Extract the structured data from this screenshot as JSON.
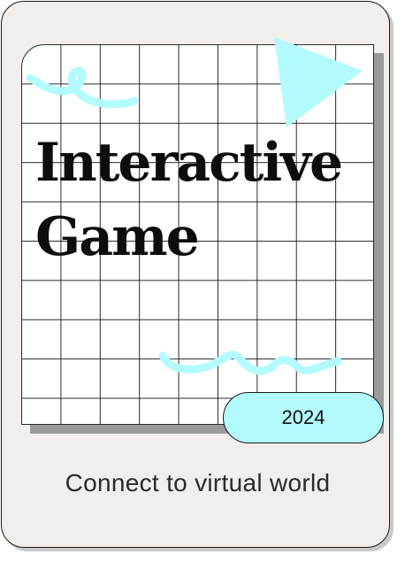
{
  "card": {
    "title_line1": "Interactive",
    "title_line2": "Game",
    "year": "2024",
    "tagline": "Connect to virtual world"
  },
  "colors": {
    "accent": "#b3fafd",
    "background": "#f1eeeb",
    "ink": "#0d0d0d"
  },
  "decorations": {
    "top_left": "squiggle-loop",
    "top_right": "triangle",
    "bottom": "wave-squiggle"
  }
}
